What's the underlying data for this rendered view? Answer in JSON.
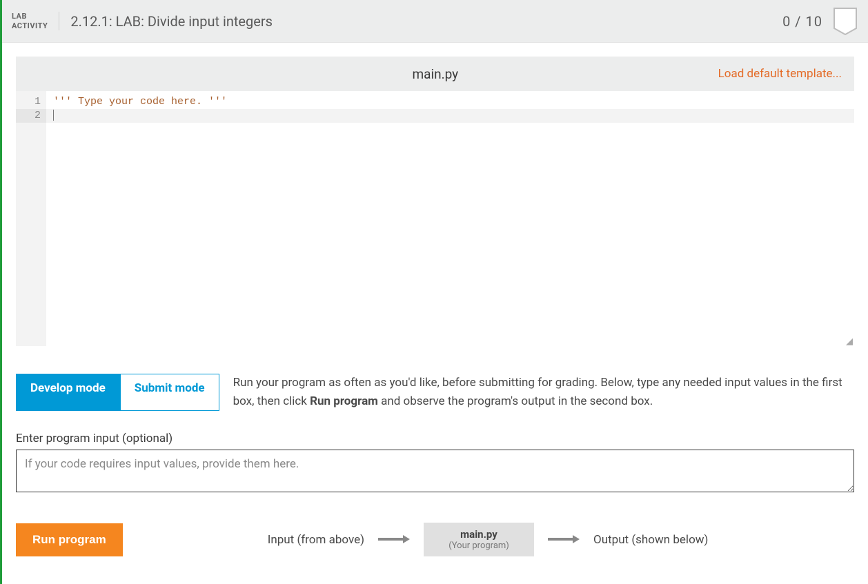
{
  "header": {
    "activity_label_l1": "LAB",
    "activity_label_l2": "ACTIVITY",
    "title": "2.12.1: LAB: Divide input integers",
    "score": "0 / 10"
  },
  "editor": {
    "filename": "main.py",
    "load_template": "Load default template...",
    "lines": [
      "''' Type your code here. '''",
      ""
    ],
    "line_numbers": [
      "1",
      "2"
    ]
  },
  "modes": {
    "develop": "Develop mode",
    "submit": "Submit mode",
    "description_pre": "Run your program as often as you'd like, before submitting for grading. Below, type any needed input values in the first box, then click ",
    "description_bold": "Run program",
    "description_post": " and observe the program's output in the second box."
  },
  "input": {
    "label": "Enter program input (optional)",
    "placeholder": "If your code requires input values, provide them here."
  },
  "run": {
    "button": "Run program",
    "input_flow": "Input (from above)",
    "program_name": "main.py",
    "program_sub": "(Your program)",
    "output_flow": "Output (shown below)"
  }
}
